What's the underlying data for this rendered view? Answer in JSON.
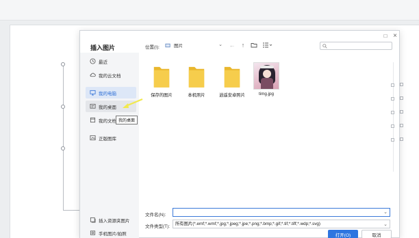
{
  "dialog": {
    "title": "插入图片",
    "maximize_glyph": "□",
    "close_glyph": "×"
  },
  "sidebar": {
    "items": [
      {
        "label": "最近",
        "icon": "clock-icon"
      },
      {
        "label": "我的云文档",
        "icon": "cloud-icon"
      },
      {
        "label": "我的电脑",
        "icon": "computer-icon",
        "active": true
      },
      {
        "label": "我的桌面",
        "icon": "desktop-icon",
        "hover": true
      },
      {
        "label": "我的文档",
        "icon": "document-icon"
      },
      {
        "label": "正版图库",
        "icon": "gallery-icon"
      }
    ],
    "bottom_items": [
      {
        "label": "插入资源夹图片",
        "icon": "resource-folder-icon"
      },
      {
        "label": "手机图片/拍照",
        "icon": "phone-icon"
      }
    ],
    "tooltip": "我的桌面"
  },
  "toolbar": {
    "location_label": "位置(I):",
    "location_value": "图片",
    "search_placeholder": ""
  },
  "files": [
    {
      "name": "保存的图片",
      "type": "folder"
    },
    {
      "name": "本机照片",
      "type": "folder"
    },
    {
      "name": "逍遥安卓照片",
      "type": "folder"
    },
    {
      "name": "timg.jpg",
      "type": "image"
    }
  ],
  "bottom": {
    "filename_label": "文件名(N):",
    "filename_value": "",
    "filetype_label": "文件类型(T):",
    "filetype_value": "所有图片(*.emf;*.wmf;*.jpg;*.jpeg;*.jpe;*.png;*.bmp;*.gif;*.tif;*.tiff;*.wdp;*.svg)",
    "open_button": "打开(O)",
    "cancel_button": "取消"
  },
  "colors": {
    "accent": "#2e75e0",
    "folder": "#f5c842",
    "annotation_arrow": "#f2e94e"
  }
}
